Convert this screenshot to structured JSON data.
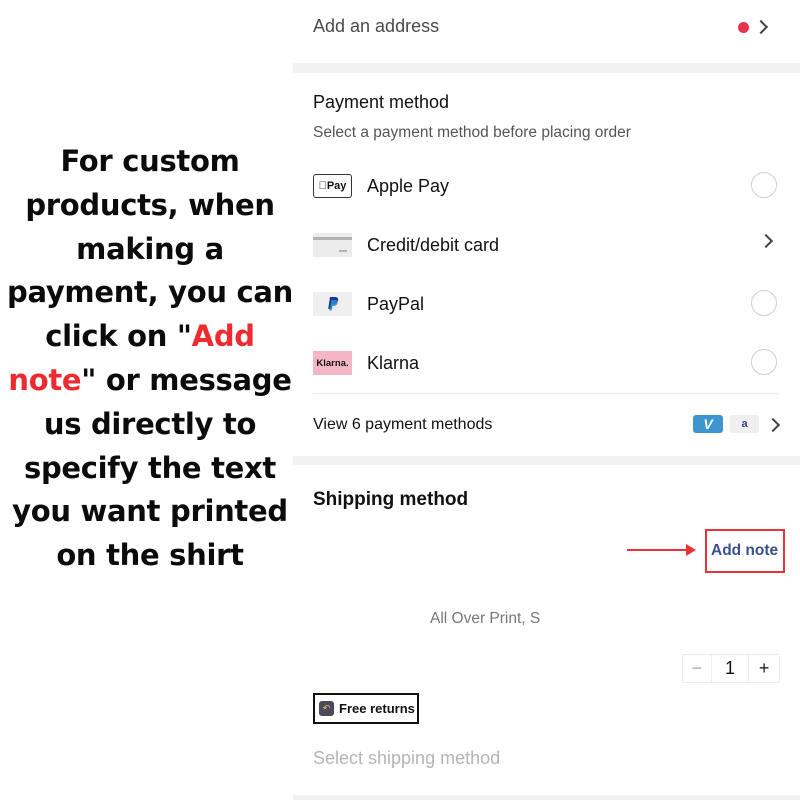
{
  "caption": {
    "before": "For custom products, when making a payment, you can click on \"",
    "highlight": "Add note",
    "after": "\" or message us directly to specify the text you want printed on the shirt",
    "highlight_color": "#ee2a31"
  },
  "address": {
    "label": "Add an address",
    "alert_dot_color": "#e8334a"
  },
  "payment": {
    "title": "Payment method",
    "subtitle": "Select a payment method before placing order",
    "methods": [
      {
        "label": "Apple Pay",
        "icon": "apple-pay-icon",
        "icon_text": "Pay",
        "control": "radio"
      },
      {
        "label": "Credit/debit card",
        "icon": "credit-card-icon",
        "control": "chevron"
      },
      {
        "label": "PayPal",
        "icon": "paypal-icon",
        "icon_text": "P",
        "control": "radio"
      },
      {
        "label": "Klarna",
        "icon": "klarna-icon",
        "icon_text": "Klarna.",
        "control": "radio"
      }
    ],
    "view_more": "View 6 payment methods",
    "extra_icons": [
      {
        "name": "venmo-icon",
        "text": "V"
      },
      {
        "name": "affirm-icon",
        "text": "a"
      }
    ]
  },
  "shipping": {
    "title": "Shipping method",
    "add_note": "Add note",
    "variant": "All Over Print, S",
    "quantity": {
      "minus": "−",
      "value": "1",
      "plus": "+"
    },
    "free_returns": "Free returns",
    "select_placeholder": "Select shipping method"
  },
  "colors": {
    "annotation_red": "#e8333a",
    "link_blue": "#3b4f8f"
  }
}
